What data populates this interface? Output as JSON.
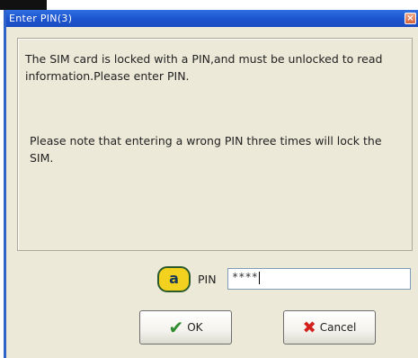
{
  "window": {
    "title": "Enter PIN(3)",
    "close_glyph": "×"
  },
  "message": {
    "line1": "The SIM card is locked with a PIN,and must be unlocked to read information.Please enter PIN.",
    "line2": "Please note that entering a wrong PIN three times will lock the SIM."
  },
  "pin": {
    "badge": "a",
    "label": "PIN",
    "value": "****"
  },
  "buttons": {
    "ok_label": "OK",
    "cancel_label": "Cancel"
  },
  "icons": {
    "ok": "check-icon",
    "cancel": "cross-icon",
    "close": "close-icon"
  }
}
